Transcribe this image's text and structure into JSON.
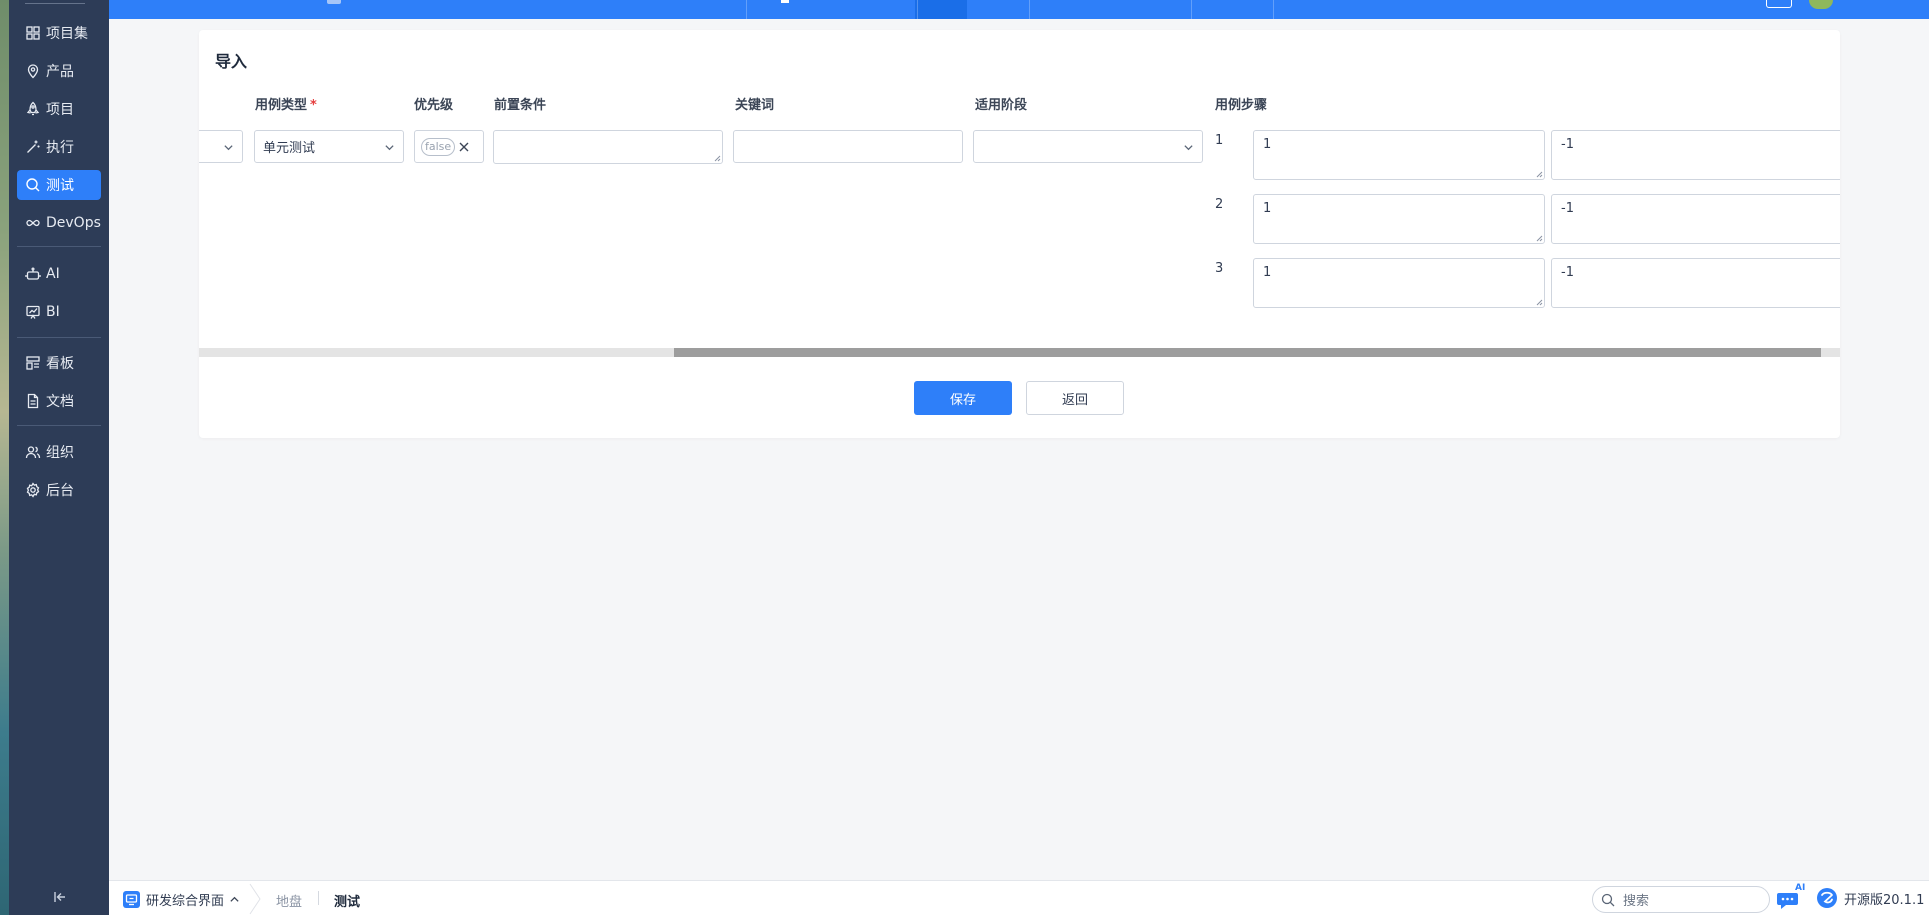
{
  "sidebar": {
    "items": [
      {
        "label": "项目集",
        "icon": "grid-icon"
      },
      {
        "label": "产品",
        "icon": "location-pin-icon"
      },
      {
        "label": "项目",
        "icon": "rocket-icon"
      },
      {
        "label": "执行",
        "icon": "magic-wand-icon"
      },
      {
        "label": "测试",
        "icon": "search-icon",
        "active": true
      },
      {
        "label": "DevOps",
        "icon": "infinity-icon"
      },
      {
        "label": "AI",
        "icon": "robot-icon"
      },
      {
        "label": "BI",
        "icon": "chart-board-icon"
      },
      {
        "label": "看板",
        "icon": "kanban-icon"
      },
      {
        "label": "文档",
        "icon": "document-icon"
      },
      {
        "label": "组织",
        "icon": "users-icon"
      },
      {
        "label": "后台",
        "icon": "gear-icon"
      }
    ]
  },
  "page": {
    "title": "导入",
    "columns": {
      "case_type": "用例类型",
      "required_mark": "*",
      "priority": "优先级",
      "precondition": "前置条件",
      "keywords": "关键词",
      "stage": "适用阶段",
      "steps": "用例步骤"
    },
    "row": {
      "case_type_value": "单元测试",
      "priority_value": "false",
      "precondition_value": "",
      "keywords_value": "",
      "stage_value": ""
    },
    "steps": [
      {
        "no": "1",
        "desc": "1",
        "expect": "-1"
      },
      {
        "no": "2",
        "desc": "1",
        "expect": "-1"
      },
      {
        "no": "3",
        "desc": "1",
        "expect": "-1"
      }
    ],
    "save_label": "保存",
    "back_label": "返回"
  },
  "bottombar": {
    "app_name": "研发综合界面",
    "crumb_1": "地盘",
    "crumb_2": "测试",
    "search_placeholder": "搜索",
    "ai_badge": "AI",
    "version": "开源版20.1.1"
  },
  "colors": {
    "primary": "#2e7ff9",
    "sidebar_bg": "#2d3c57",
    "required": "#e53e3e"
  }
}
